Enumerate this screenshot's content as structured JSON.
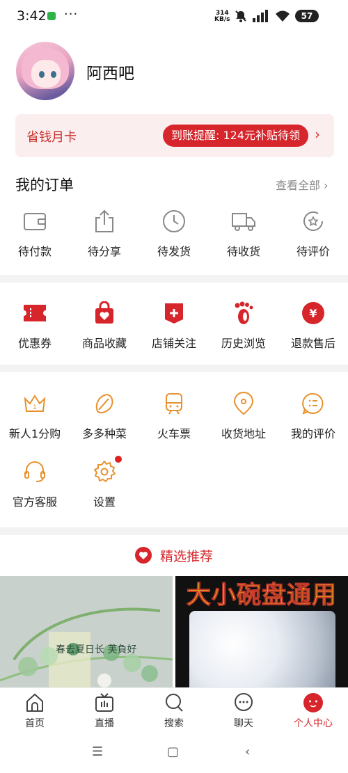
{
  "status_bar": {
    "time": "3:42",
    "net_speed_top": "314",
    "net_speed_unit": "KB/s",
    "battery": "57"
  },
  "profile": {
    "username": "阿西吧"
  },
  "money_card": {
    "title": "省钱月卡",
    "pill": "到账提醒: 124元补贴待领",
    "arrow": "›"
  },
  "orders": {
    "title": "我的订单",
    "view_all": "查看全部 ›",
    "items": [
      {
        "label": "待付款",
        "icon": "wallet-icon"
      },
      {
        "label": "待分享",
        "icon": "share-icon"
      },
      {
        "label": "待发货",
        "icon": "clock-icon"
      },
      {
        "label": "待收货",
        "icon": "truck-icon"
      },
      {
        "label": "待评价",
        "icon": "review-icon"
      }
    ]
  },
  "shortcuts": [
    {
      "label": "优惠券",
      "icon": "coupon-icon"
    },
    {
      "label": "商品收藏",
      "icon": "favorite-bag-icon"
    },
    {
      "label": "店铺关注",
      "icon": "store-follow-icon"
    },
    {
      "label": "历史浏览",
      "icon": "footprint-icon"
    },
    {
      "label": "退款售后",
      "icon": "refund-icon"
    }
  ],
  "services": [
    {
      "label": "新人1分购",
      "icon": "crown-icon"
    },
    {
      "label": "多多种菜",
      "icon": "vegetable-icon"
    },
    {
      "label": "火车票",
      "icon": "train-icon"
    },
    {
      "label": "收货地址",
      "icon": "location-icon"
    },
    {
      "label": "我的评价",
      "icon": "comment-icon"
    },
    {
      "label": "官方客服",
      "icon": "headset-icon"
    },
    {
      "label": "设置",
      "icon": "settings-icon"
    }
  ],
  "recommend": {
    "title": "精选推荐"
  },
  "products": [
    {
      "image": "jade-bracelet-image",
      "overlay_text": "春去夏日长 芙負好"
    },
    {
      "image": "bowl-cover-image",
      "banner": "大小碗盘通用"
    }
  ],
  "tabbar": [
    {
      "label": "首页",
      "icon": "home-icon",
      "active": false
    },
    {
      "label": "直播",
      "icon": "live-tv-icon",
      "active": false
    },
    {
      "label": "搜索",
      "icon": "search-icon",
      "active": false
    },
    {
      "label": "聊天",
      "icon": "chat-icon",
      "active": false
    },
    {
      "label": "个人中心",
      "icon": "profile-icon",
      "active": true
    }
  ],
  "nav": {
    "menu": "☰",
    "home": "▢",
    "back": "‹"
  },
  "colors": {
    "accent": "#d6252b",
    "orange": "#e8912d",
    "bg_gray": "#f3f3f3"
  }
}
